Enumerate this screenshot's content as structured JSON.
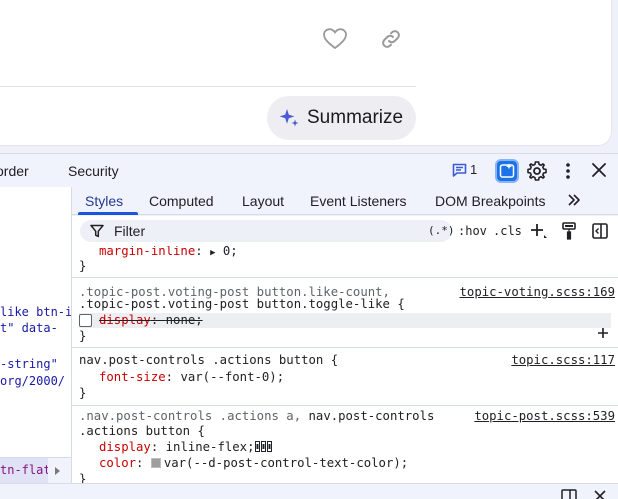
{
  "webpage": {
    "summarize_label": "Summarize"
  },
  "devtools": {
    "top_tabs": [
      "order",
      "Security"
    ],
    "issues_count": "1",
    "styles_tabs": [
      "Styles",
      "Computed",
      "Layout",
      "Event Listeners",
      "DOM Breakpoints"
    ],
    "more_tabs_icon": "chevron-double-right-icon",
    "filter_placeholder": "Filter",
    "regex_toggle": "(.*)",
    "hov_toggle": ":hov",
    "cls_toggle": ".cls",
    "elements_lines": [
      {
        "attr": "like btn-i"
      },
      {
        "attr": "t\" data-"
      },
      {
        "attr": "-string\""
      },
      {
        "attr": "org/2000/"
      }
    ],
    "breadcrumb": "tn-flat",
    "rules": [
      {
        "partial_prop": "margin-inline",
        "partial_value": "0;"
      },
      {
        "selector_line1": ".topic-post.voting-post button.like-count,",
        "selector_line2": ".topic-post.voting-post button.toggle-like {",
        "source": "topic-voting.scss:169",
        "prop": "display",
        "value": "none;"
      },
      {
        "selector_line1": "nav.post-controls .actions button {",
        "source": "topic.scss:117",
        "prop": "font-size",
        "value": "var(--font-0);"
      },
      {
        "selector_line1_dim": ".nav.post-controls .actions a,",
        "selector_line1_rest": " nav.post-controls",
        "selector_line2": ".actions button {",
        "source": "topic-post.scss:539",
        "prop1": "display",
        "value1": "inline-flex;",
        "prop2": "color",
        "value2": "var(--d-post-control-text-color);"
      }
    ],
    "close_brace": "}"
  },
  "colors": {
    "accent": "#1a56db",
    "prop_name": "#c80000",
    "tag": "#881280"
  }
}
